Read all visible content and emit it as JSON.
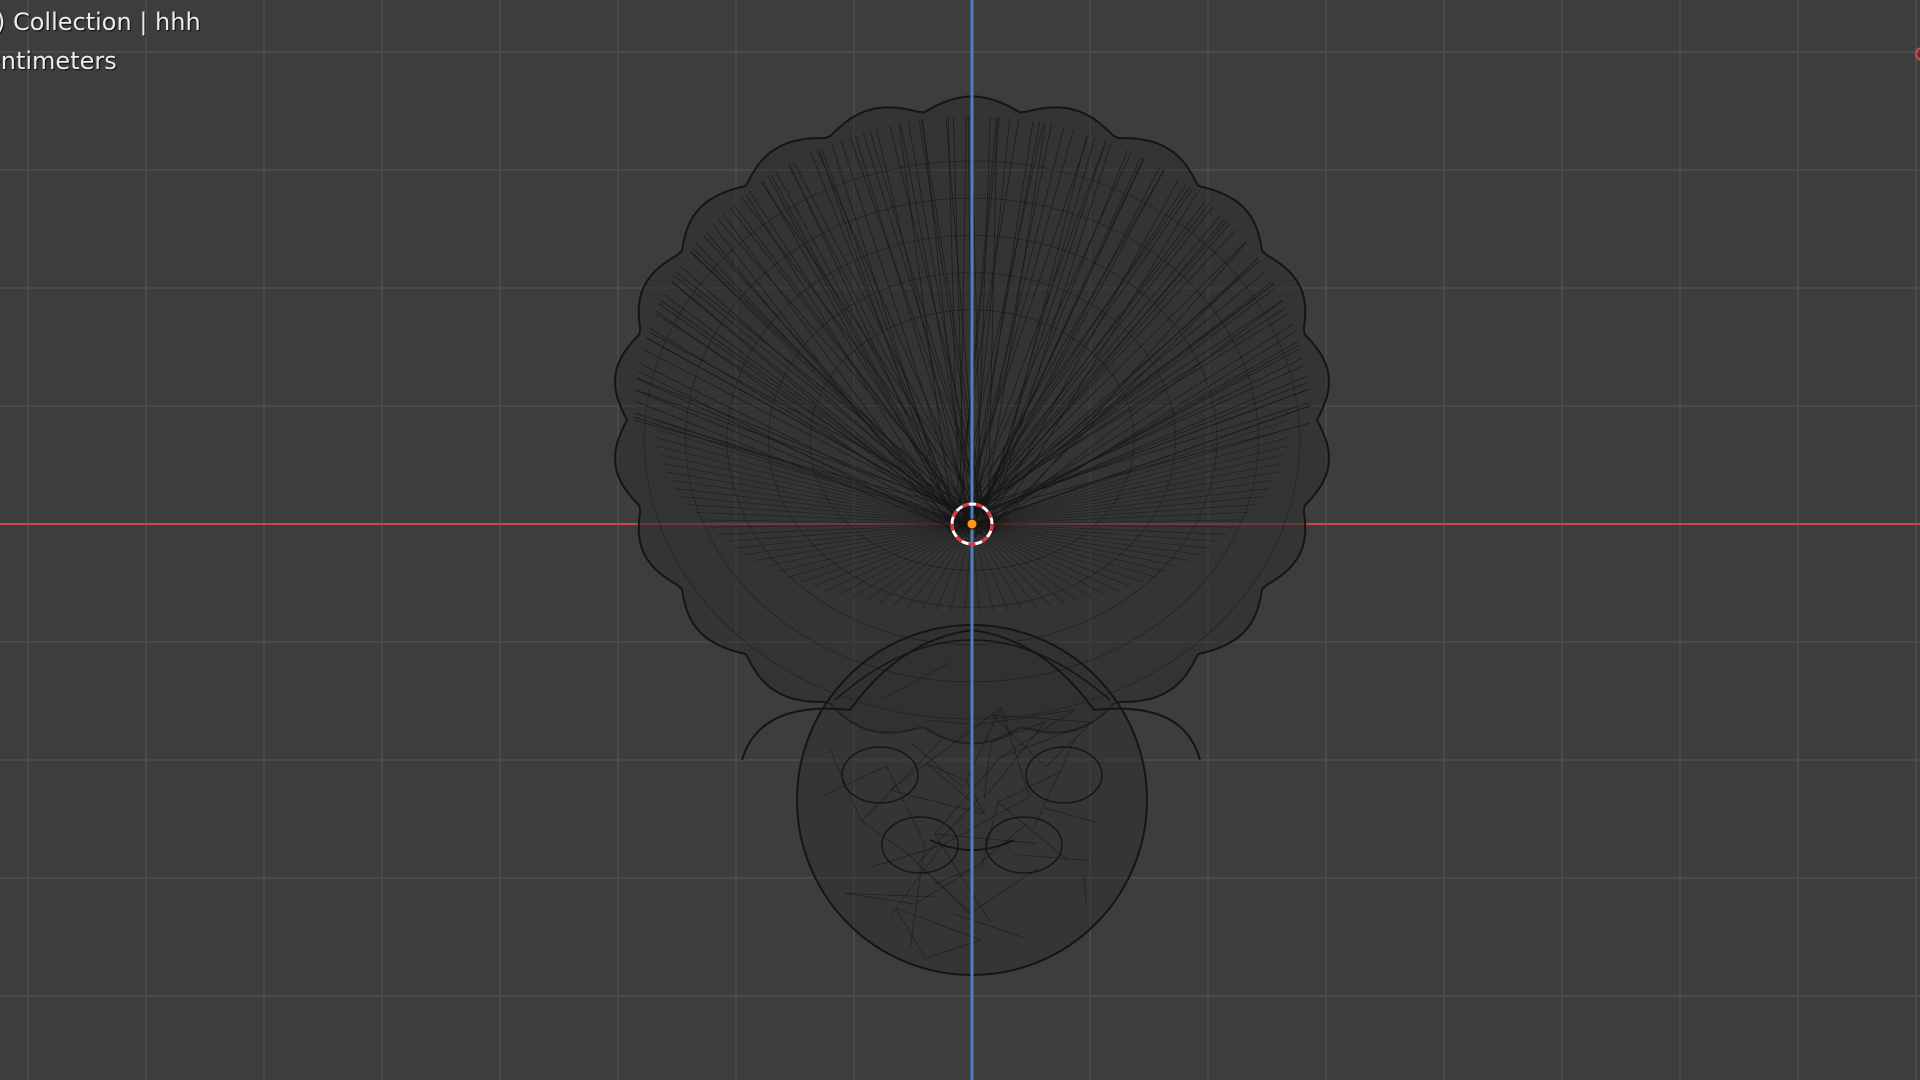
{
  "viewport": {
    "view_layer_text": ") Collection | hhh",
    "unit_text": "entimeters",
    "colors": {
      "background": "#3d3d3d",
      "grid_line": "#4a4a4a",
      "x_axis": "#c8464f",
      "y_axis": "#4d7fc4",
      "wire": "#151515",
      "origin": "#ff9a1f",
      "cursor_red": "#e8333a"
    },
    "icons": {
      "cursor": "3d-cursor-icon",
      "origin": "object-origin-icon",
      "gizmo": "navigation-gizmo-x-icon"
    }
  }
}
